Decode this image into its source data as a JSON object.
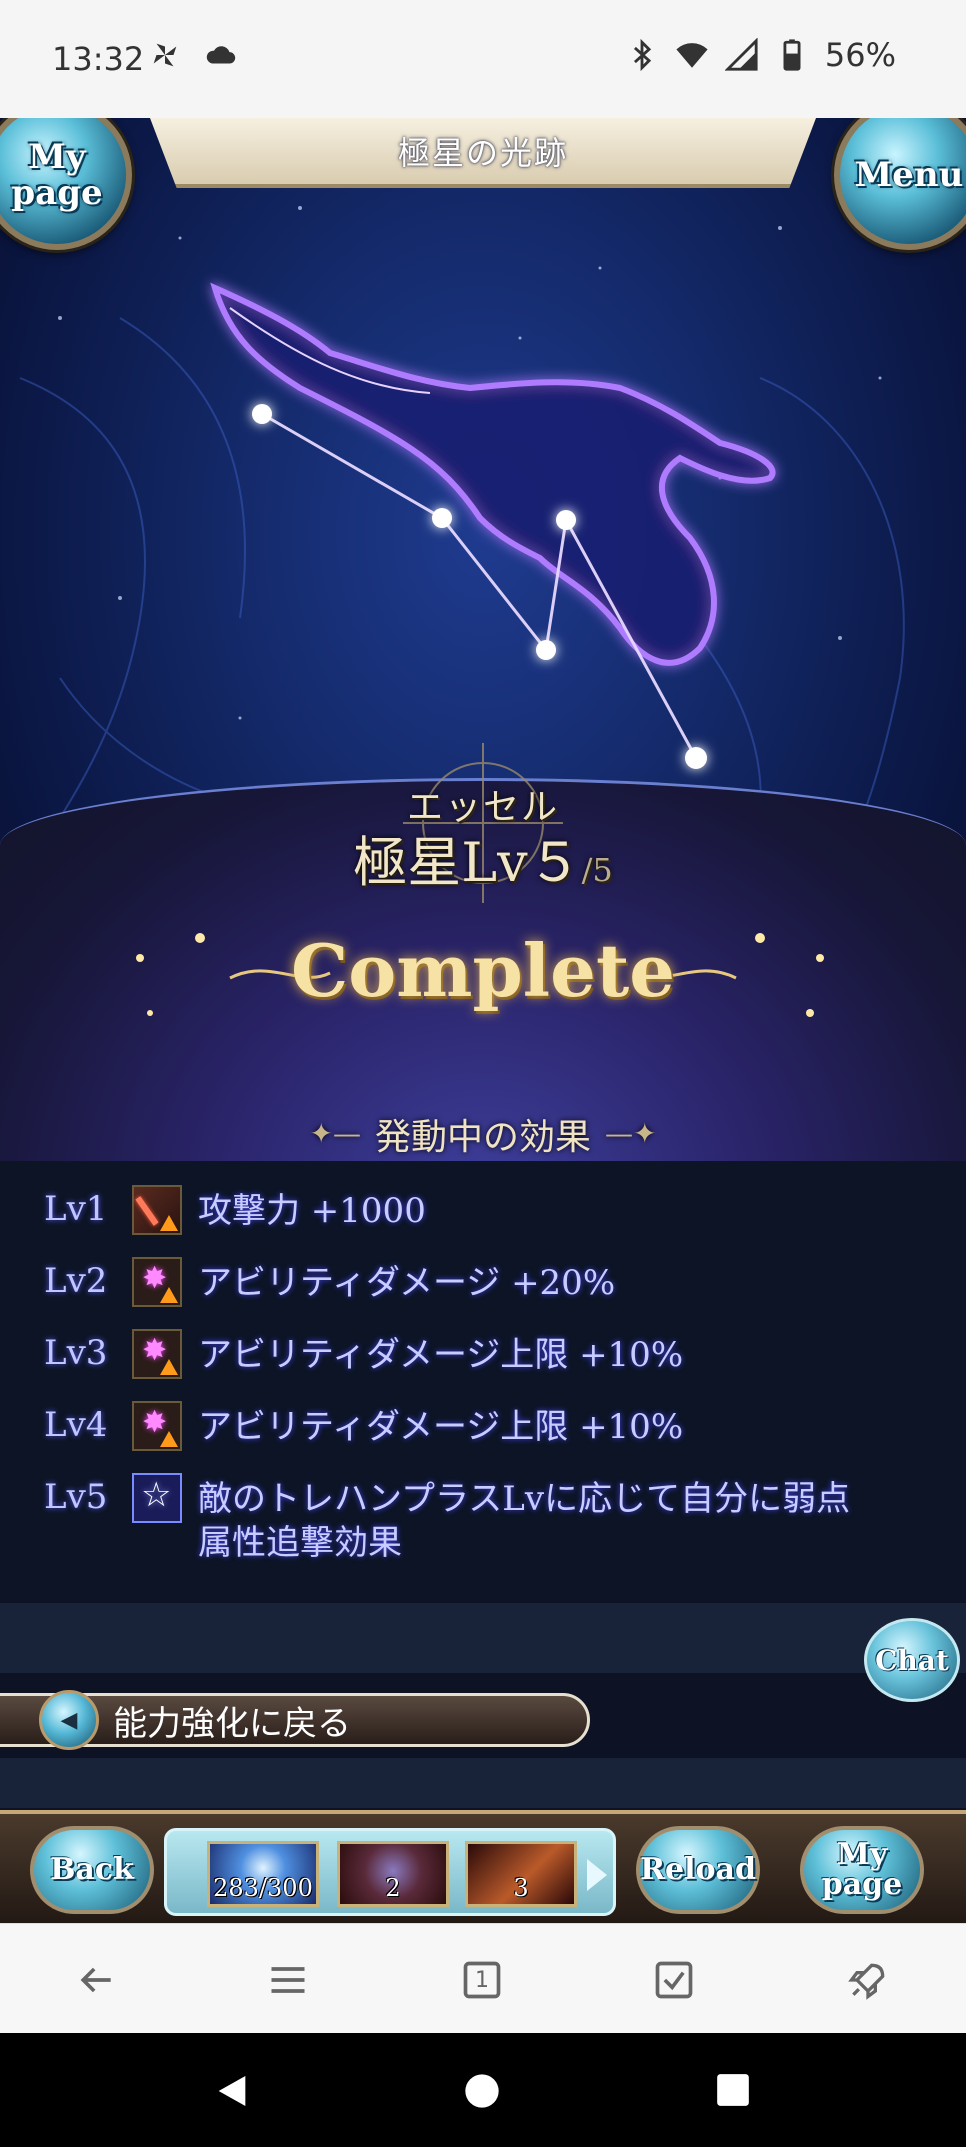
{
  "status_bar": {
    "time": "13:32",
    "battery": "56%",
    "icons": [
      "pinwheel-icon",
      "cloud-icon",
      "bluetooth-icon",
      "wifi-icon",
      "signal-icon",
      "battery-icon"
    ]
  },
  "header": {
    "title": "極星の光跡",
    "my_page_label": "My\npage",
    "menu_label": "Menu"
  },
  "summon": {
    "name": "エッセル",
    "level_text": "極星Lv５",
    "level_max": "/5",
    "status": "Complete"
  },
  "effects": {
    "heading": "発動中の効果",
    "items": [
      {
        "level": "Lv1",
        "icon": "attack-up-icon",
        "text": "攻撃力 +1000"
      },
      {
        "level": "Lv2",
        "icon": "ability-damage-up-icon",
        "text": "アビリティダメージ +20%"
      },
      {
        "level": "Lv3",
        "icon": "ability-damage-up-icon",
        "text": "アビリティダメージ上限 +10%"
      },
      {
        "level": "Lv4",
        "icon": "ability-damage-up-icon",
        "text": "アビリティダメージ上限 +10%"
      },
      {
        "level": "Lv5",
        "icon": "star-icon",
        "text": "敵のトレハンプラスLvに応じて自分に弱点\n属性追撃効果"
      }
    ]
  },
  "chat_label": "Chat",
  "back_link": "能力強化に戻る",
  "bottom_nav": {
    "back": "Back",
    "reload": "Reload",
    "my_page": "My\npage",
    "items": [
      {
        "name": "ap",
        "count": "283/300"
      },
      {
        "name": "item-1",
        "count": "2"
      },
      {
        "name": "item-2",
        "count": "3"
      }
    ]
  },
  "browser": {
    "tab_count": "1"
  }
}
